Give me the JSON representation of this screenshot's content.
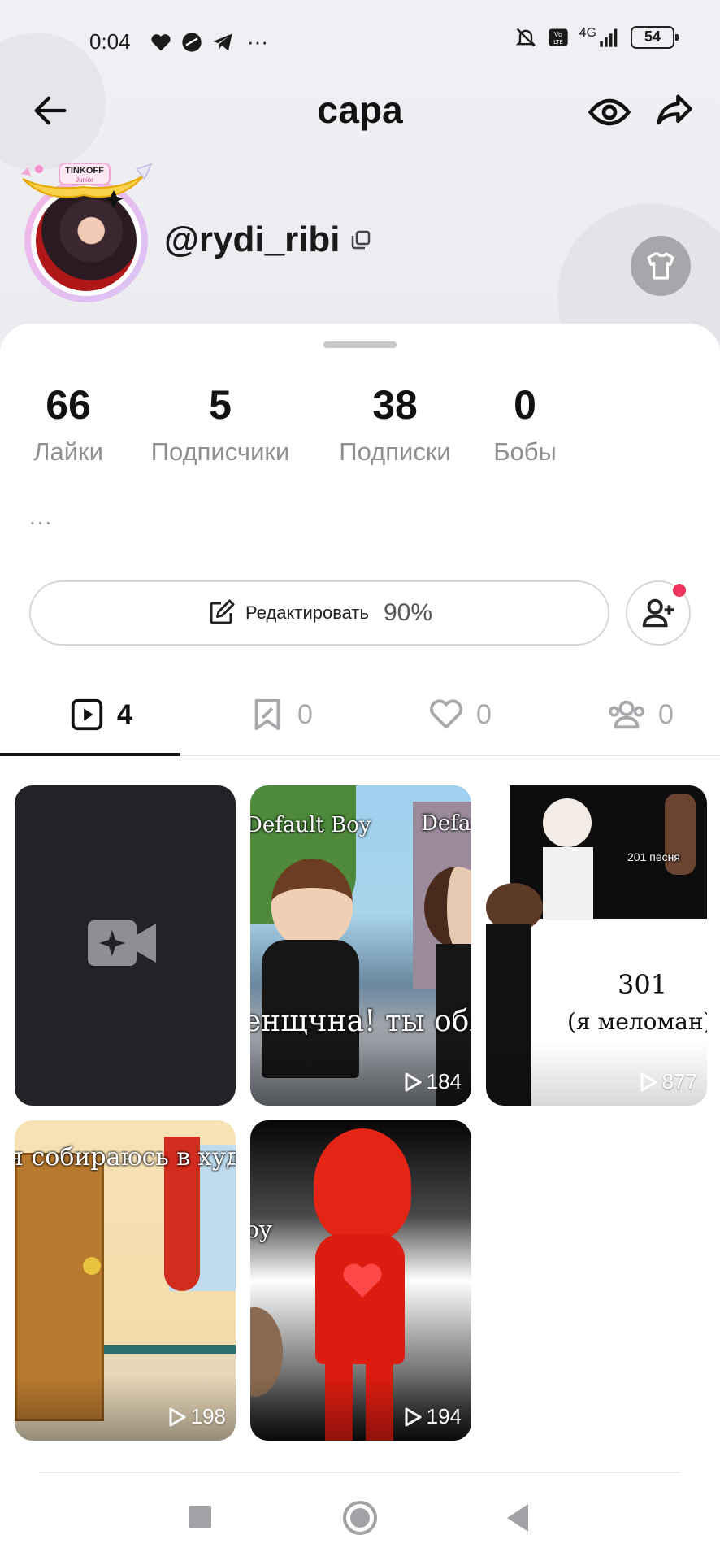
{
  "status_bar": {
    "time": "0:04",
    "extra": "···",
    "network": "4G",
    "battery": "54"
  },
  "nav": {
    "title": "сара"
  },
  "profile": {
    "badge_brand": "TINKOFF",
    "badge_sub": "Junior",
    "username": "@rydi_ribi"
  },
  "stats": [
    {
      "value": "66",
      "label": "Лайки"
    },
    {
      "value": "5",
      "label": "Подписчики"
    },
    {
      "value": "38",
      "label": "Подписки"
    },
    {
      "value": "0",
      "label": "Бобы"
    }
  ],
  "bio": "...",
  "edit": {
    "label": "Редактировать",
    "percent": "90%"
  },
  "tabs": [
    {
      "icon": "video-icon",
      "count": "4"
    },
    {
      "icon": "bookmark-icon",
      "count": "0"
    },
    {
      "icon": "heart-icon",
      "count": "0"
    },
    {
      "icon": "group-icon",
      "count": "0"
    }
  ],
  "videos": [
    {
      "type": "create",
      "views": ""
    },
    {
      "caption_top": "Default Boy",
      "caption_top2": "Defau",
      "caption": "енщчна! ты обяза",
      "views": "184"
    },
    {
      "caption_top": "201 песня",
      "caption": "301",
      "caption2": "(я меломан)",
      "views": "877"
    },
    {
      "caption": "я собираюсь в худож",
      "views": "198"
    },
    {
      "caption_top": "oy",
      "views": "194"
    }
  ],
  "colors": {
    "accent_dot": "#f0325f",
    "sheet": "#ffffff",
    "muted": "#8e8e93"
  }
}
